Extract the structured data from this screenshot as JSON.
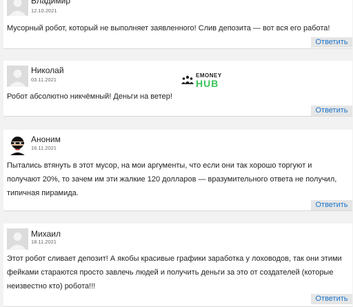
{
  "reply_label": "Ответить",
  "logo": {
    "line1": "EMONEY",
    "line2": "HUB",
    "accent_color": "#3ac35a"
  },
  "comments": [
    {
      "name": "Владимир",
      "date": "12.10.2021",
      "text": "Мусорный робот, который не выполняет заявленного! Слив депозита — вот вся его работа!"
    },
    {
      "name": "Николай",
      "date": "03.11.2021",
      "text": "Робот абсолютно никчёмный! Деньги на ветер!"
    },
    {
      "name": "Аноним",
      "date": "16.11.2021",
      "text": "Пытались втянуть в этот мусор, на мои аргументы, что если они так хорошо торгуют и получают 20%, то зачем им эти жалкие 120 долларов — вразумительного ответа не получил, типичная пирамида."
    },
    {
      "name": "Михаил",
      "date": "18.11.2021",
      "text": "Этот робот сливает депозит! А якобы красивые графики заработка у лоховодов, так они этими фейками стараются просто завлечь людей и получить деньги за это от создателей (которые неизвестно кто) робота!!!"
    }
  ]
}
